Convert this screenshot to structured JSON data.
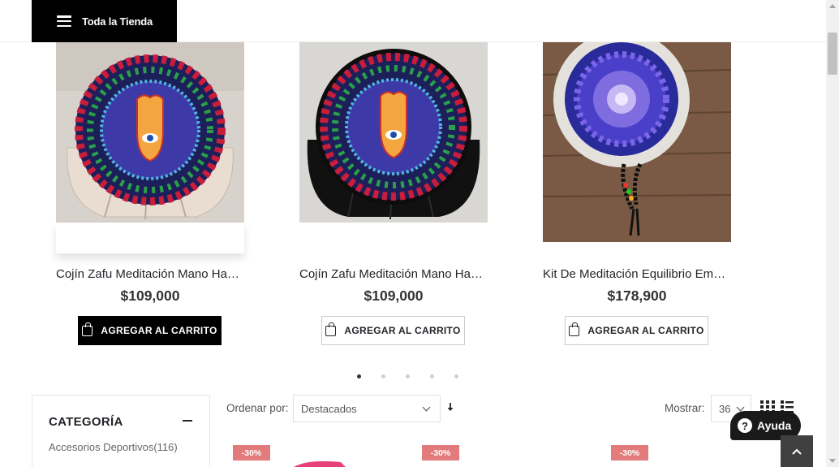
{
  "header": {
    "store_button_label": "Toda la Tienda"
  },
  "carousel": {
    "products": [
      {
        "name": "Cojín Zafu Meditación Mano Ha…",
        "price": "$109,000",
        "cart_label": "AGREGAR AL CARRITO"
      },
      {
        "name": "Cojín Zafu Meditación Mano Ha…",
        "price": "$109,000",
        "cart_label": "AGREGAR AL CARRITO"
      },
      {
        "name": "Kit De Meditación Equilibrio Em…",
        "price": "$178,900",
        "cart_label": "AGREGAR AL CARRITO"
      }
    ],
    "page_count": 5,
    "active_page": 1
  },
  "sidebar": {
    "title": "CATEGORÍA",
    "items": [
      {
        "label": "Accesorios Deportivos(116)"
      }
    ]
  },
  "toolbar": {
    "sort_label": "Ordenar por:",
    "sort_value": "Destacados",
    "show_label": "Mostrar:",
    "show_value": "36"
  },
  "grid_badges": [
    "-30%",
    "-30%",
    "-30%"
  ],
  "help": {
    "label": "Ayuda"
  },
  "colors": {
    "sale_badge": "#e27c7c",
    "primary_dark": "#000000",
    "help_bg": "#1a1a1a"
  }
}
